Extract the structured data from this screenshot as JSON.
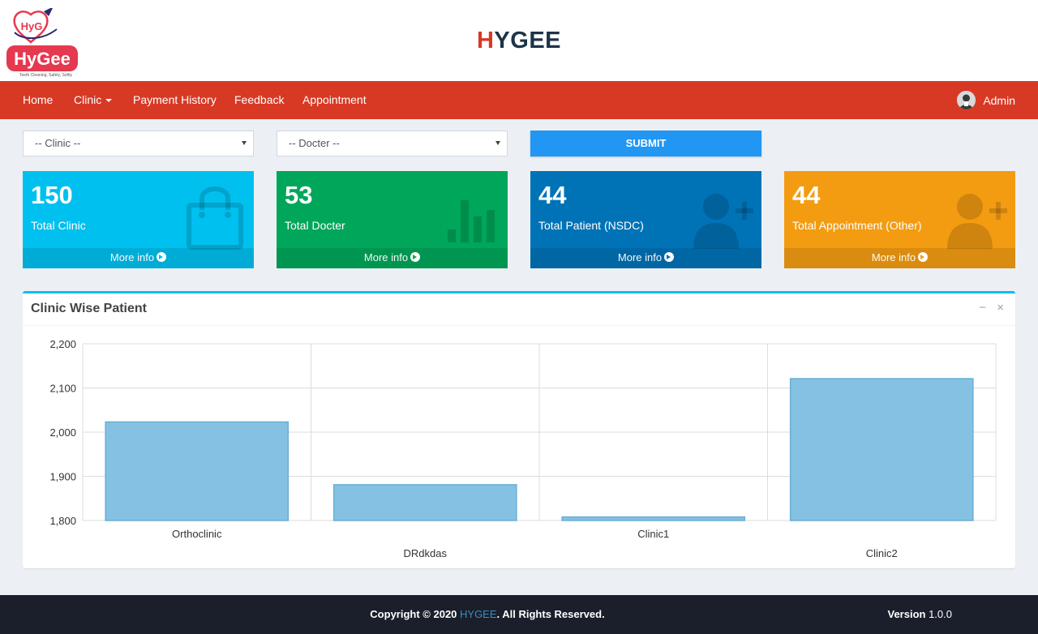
{
  "header": {
    "logo": {
      "top_text": "HyG",
      "main_text": "HyGee",
      "tagline": "Teeth Cleaning, Safely, Softly"
    },
    "brand_accent": "H",
    "brand_rest": "YGEE"
  },
  "nav": {
    "items": [
      "Home",
      "Clinic",
      "Payment History",
      "Feedback",
      "Appointment"
    ],
    "user": "Admin"
  },
  "filters": {
    "clinic_select": "-- Clinic --",
    "doctor_select": "-- Docter --",
    "submit_label": "SUBMIT"
  },
  "stats": [
    {
      "value": "150",
      "label": "Total Clinic",
      "more": "More info",
      "color": "#00c0ef",
      "icon": "shopping-bag-icon"
    },
    {
      "value": "53",
      "label": "Total Docter",
      "more": "More info",
      "color": "#00a65a",
      "icon": "bar-chart-icon"
    },
    {
      "value": "44",
      "label": "Total Patient (NSDC)",
      "more": "More info",
      "color": "#0073b7",
      "icon": "user-plus-icon"
    },
    {
      "value": "44",
      "label": "Total Appointment (Other)",
      "more": "More info",
      "color": "#f39c12",
      "icon": "user-plus-icon"
    }
  ],
  "panel": {
    "title": "Clinic Wise Patient",
    "collapse": "−",
    "close": "×"
  },
  "chart_data": {
    "type": "bar",
    "title": "Clinic Wise Patient",
    "categories": [
      "Orthoclinic",
      "DRdkdas",
      "Clinic1",
      "Clinic2"
    ],
    "values": [
      2023,
      1881,
      1808,
      2121
    ],
    "ylim": [
      1800,
      2200
    ],
    "yticks": [
      "1,800",
      "1,900",
      "2,000",
      "2,100",
      "2,200"
    ],
    "grid": true,
    "bar_color": "#84c1e3"
  },
  "footer": {
    "copyright_prefix": "Copyright © 2020 ",
    "copyright_link": "HYGEE",
    "copyright_suffix": ". All Rights Reserved.",
    "version_label": "Version",
    "version_value": "1.0.0"
  }
}
